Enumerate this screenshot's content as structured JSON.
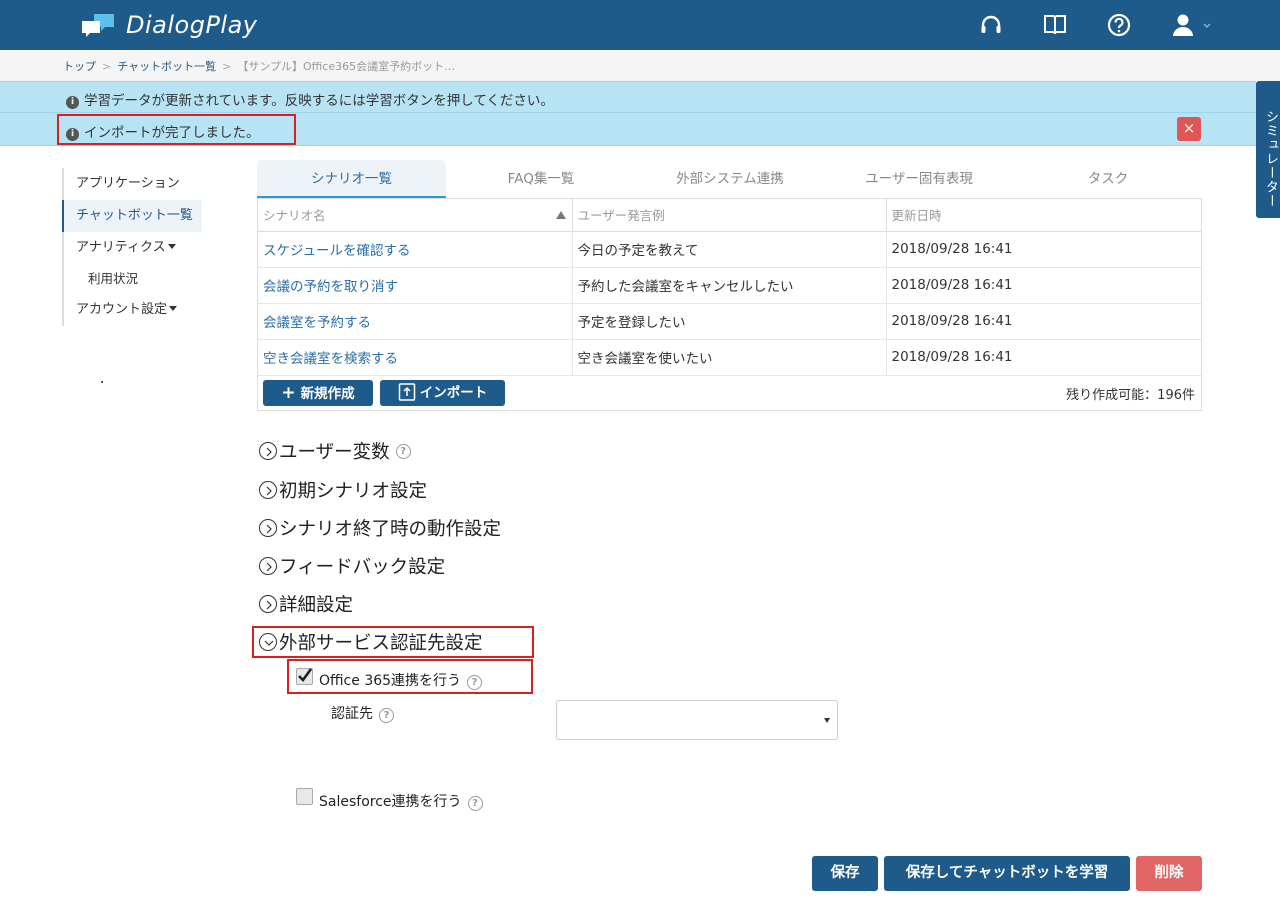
{
  "header": {
    "brand": "DialogPlay",
    "icons": [
      "headset-icon",
      "book-icon",
      "help-icon",
      "user-icon"
    ]
  },
  "breadcrumb": {
    "items": [
      "トップ",
      "チャットボット一覧",
      "【サンプル】Office365会議室予約ボット…"
    ]
  },
  "alerts": {
    "learning": "学習データが更新されています。反映するには学習ボタンを押してください。",
    "import_done": "インポートが完了しました。",
    "close": "×"
  },
  "simulator_tab": "シミュレーター",
  "leftnav": {
    "application": "アプリケーション",
    "chatbot_list": "チャットボット一覧",
    "analytics": "アナリティクス",
    "usage": "利用状況",
    "account": "アカウント設定"
  },
  "tabs": [
    "シナリオ一覧",
    "FAQ集一覧",
    "外部システム連携",
    "ユーザー固有表現",
    "タスク"
  ],
  "table": {
    "headers": [
      "シナリオ名",
      "ユーザー発言例",
      "更新日時"
    ],
    "rows": [
      [
        "スケジュールを確認する",
        "今日の予定を教えて",
        "2018/09/28 16:41"
      ],
      [
        "会議の予約を取り消す",
        "予約した会議室をキャンセルしたい",
        "2018/09/28 16:41"
      ],
      [
        "会議室を予約する",
        "予定を登録したい",
        "2018/09/28 16:41"
      ],
      [
        "空き会議室を検索する",
        "空き会議室を使いたい",
        "2018/09/28 16:41"
      ]
    ],
    "new_button": "新規作成",
    "import_button": "インポート",
    "remaining": "残り作成可能：196件"
  },
  "sections": {
    "user_vars": "ユーザー変数",
    "initial_scenario": "初期シナリオ設定",
    "scenario_end": "シナリオ終了時の動作設定",
    "feedback": "フィードバック設定",
    "details": "詳細設定",
    "external_auth": "外部サービス認証先設定"
  },
  "auth": {
    "office365_label": "Office 365連携を行う",
    "office365_checked": true,
    "auth_target_label": "認証先",
    "auth_target_value": "",
    "salesforce_label": "Salesforce連携を行う",
    "salesforce_checked": false
  },
  "actions": {
    "save": "保存",
    "save_and_learn": "保存してチャットボットを学習",
    "delete": "削除"
  },
  "colors": {
    "brand": "#1e5a8a",
    "alert_bg": "#b7e4f4",
    "danger": "#e06666",
    "highlight": "#d9201f"
  }
}
